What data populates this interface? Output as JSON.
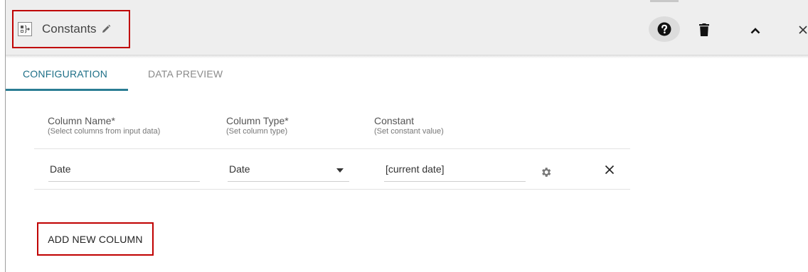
{
  "header": {
    "title": "Constants",
    "icons": [
      "node-icon",
      "pencil-icon",
      "help-icon",
      "trash-icon",
      "chevron-up-icon",
      "close-icon"
    ]
  },
  "tabs": [
    {
      "label": "CONFIGURATION",
      "active": true
    },
    {
      "label": "DATA PREVIEW",
      "active": false
    }
  ],
  "columns": [
    {
      "title": "Column Name*",
      "hint": "(Select columns from input data)"
    },
    {
      "title": "Column Type*",
      "hint": "(Set column type)"
    },
    {
      "title": "Constant",
      "hint": "(Set constant value)"
    }
  ],
  "rows": [
    {
      "name": "Date",
      "type": "Date",
      "constant": "[current date]"
    }
  ],
  "actions": {
    "add_column": "ADD NEW COLUMN"
  },
  "colors": {
    "accent": "#1d6f87",
    "highlight": "#c00000",
    "header_bg": "#eeeeee"
  }
}
